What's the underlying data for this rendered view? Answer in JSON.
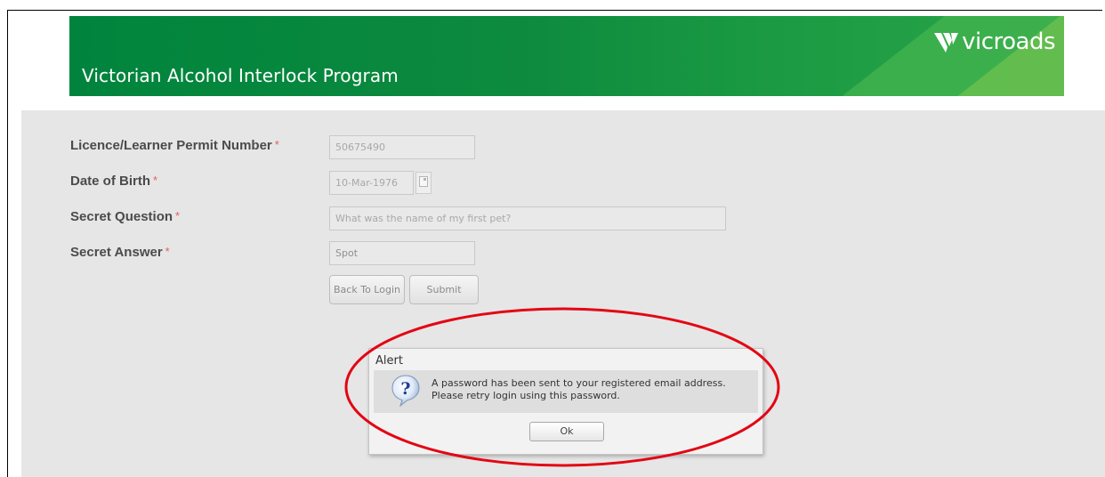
{
  "header": {
    "program_title": "Victorian Alcohol Interlock Program",
    "logo_text": "vicroads"
  },
  "form": {
    "licence": {
      "label": "Licence/Learner Permit Number",
      "required_mark": "*",
      "value": "50675490"
    },
    "dob": {
      "label": "Date of Birth",
      "required_mark": "*",
      "value": "10-Mar-1976"
    },
    "question": {
      "label": "Secret Question",
      "required_mark": "*",
      "value": "What was the name of my first pet?"
    },
    "answer": {
      "label": "Secret Answer",
      "required_mark": "*",
      "value": "Spot"
    },
    "back_label": "Back To Login",
    "submit_label": "Submit"
  },
  "alert": {
    "title": "Alert",
    "line1": "A password has been sent to your registered email address.",
    "line2": "Please retry login using this password.",
    "ok_label": "Ok",
    "icon": "question-icon"
  },
  "colors": {
    "banner_green": "#00843d",
    "annotation_red": "#e30613",
    "required_red": "#e06060"
  }
}
